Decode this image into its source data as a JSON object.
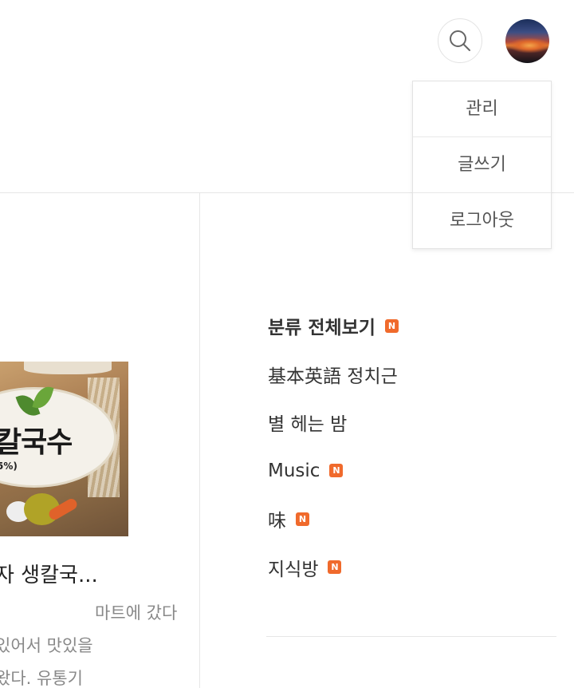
{
  "header": {
    "search_icon": "search-icon",
    "avatar_icon": "avatar"
  },
  "dropdown": {
    "items": [
      {
        "label": "관리"
      },
      {
        "label": "글쓰기"
      },
      {
        "label": "로그아웃"
      }
    ]
  },
  "post": {
    "title": "자 생칼국...",
    "excerpt_lines": [
      "마트에 갔다",
      "있어서 맛있을",
      "왔다. 유통기"
    ]
  },
  "categories": [
    {
      "label": "분류 전체보기",
      "is_new": true
    },
    {
      "label": "基本英語 정치근",
      "is_new": false
    },
    {
      "label": "별 헤는 밤",
      "is_new": false
    },
    {
      "label": "Music",
      "is_new": true
    },
    {
      "label": "味",
      "is_new": true
    },
    {
      "label": "지식방",
      "is_new": true
    }
  ],
  "badge": {
    "text": "N",
    "color": "#f06a2c"
  }
}
